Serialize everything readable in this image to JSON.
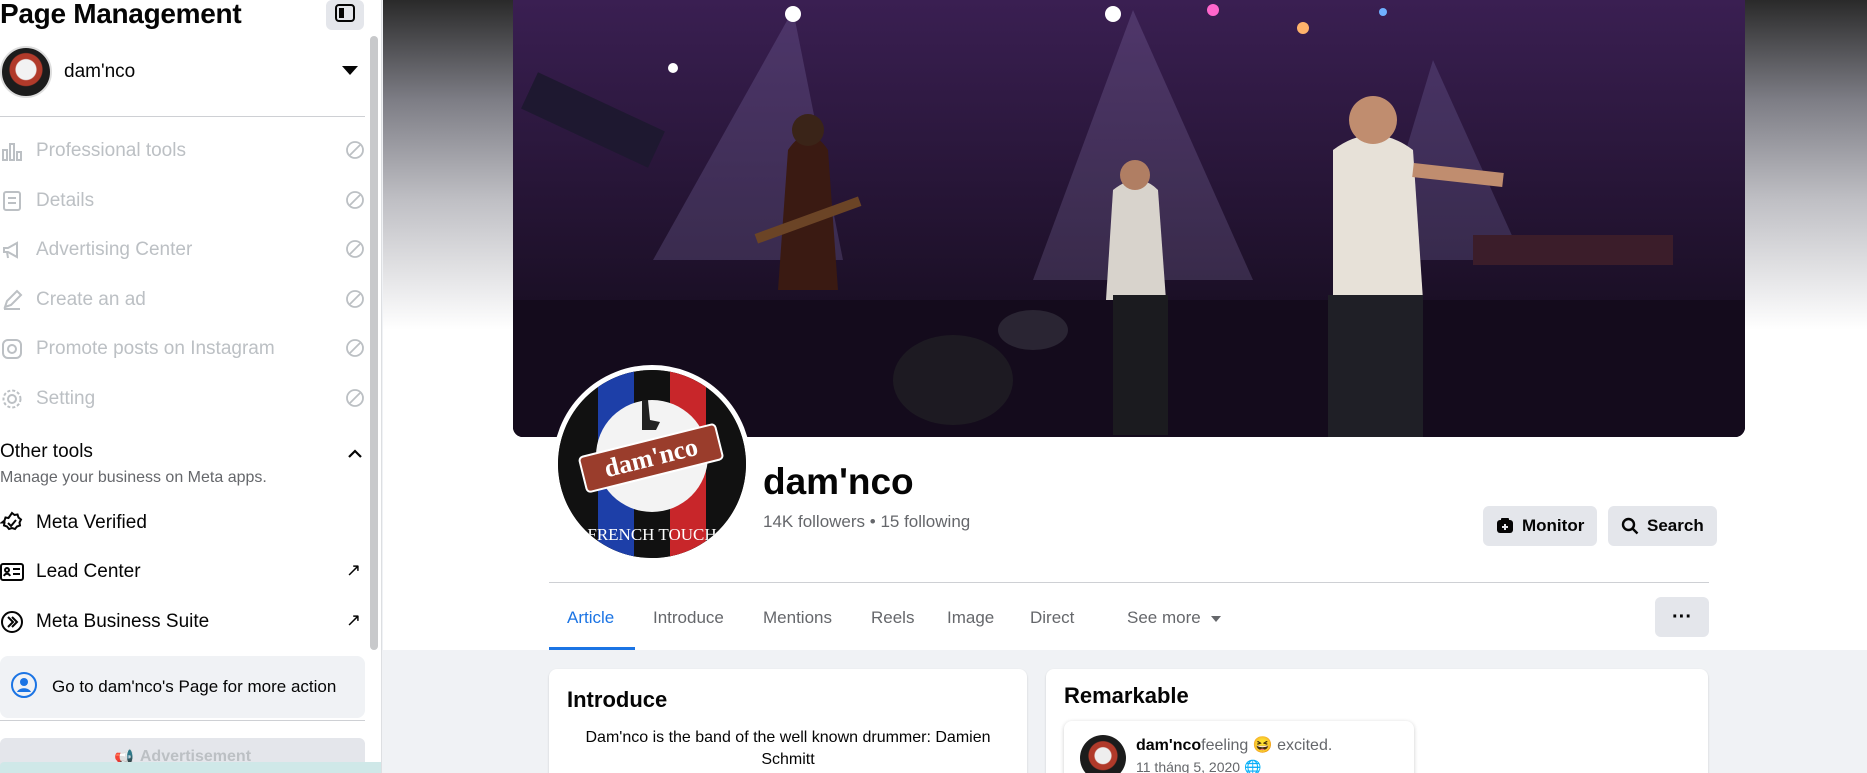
{
  "sidebar": {
    "title": "Page Management",
    "account_name": "dam'nco",
    "tools": [
      {
        "label": "Professional tools",
        "icon": "bar-chart-icon"
      },
      {
        "label": "Details",
        "icon": "details-icon"
      },
      {
        "label": "Advertising Center",
        "icon": "megaphone-icon"
      },
      {
        "label": "Create an ad",
        "icon": "pencil-icon"
      },
      {
        "label": "Promote posts on Instagram",
        "icon": "instagram-icon"
      },
      {
        "label": "Setting",
        "icon": "gear-icon"
      }
    ],
    "other_tools_title": "Other tools",
    "other_tools_subtitle": "Manage your business on Meta apps.",
    "other_tools": [
      {
        "label": "Meta Verified",
        "icon": "verified-badge-icon"
      },
      {
        "label": "Lead Center",
        "icon": "contact-card-icon"
      },
      {
        "label": "Meta Business Suite",
        "icon": "meta-business-suite-icon"
      }
    ],
    "goto_text": "Go to dam'nco's Page for more action",
    "advertisement_label": "Advertisement"
  },
  "profile": {
    "name": "dam'nco",
    "stats": "14K followers • 15 following",
    "logo_text": "dam'nco",
    "logo_subtext": "FRENCH TOUCH",
    "buttons": {
      "monitor": "Monitor",
      "search": "Search"
    }
  },
  "tabs": [
    {
      "label": "Article",
      "active": true
    },
    {
      "label": "Introduce"
    },
    {
      "label": "Mentions"
    },
    {
      "label": "Reels"
    },
    {
      "label": "Image"
    },
    {
      "label": "Direct"
    },
    {
      "label": "See more"
    }
  ],
  "more_label": "···",
  "intro": {
    "title": "Introduce",
    "text": "Dam'nco is the band of the well known drummer: Damien Schmitt"
  },
  "remarkable": {
    "title": "Remarkable",
    "post_author": "dam'nco",
    "post_feeling_prefix": "feeling",
    "post_feeling": "excited.",
    "post_date": "11 tháng 5, 2020"
  },
  "colors": {
    "accent": "#1b74e4",
    "disabled": "#bcc0c4",
    "muted": "#65676b"
  }
}
